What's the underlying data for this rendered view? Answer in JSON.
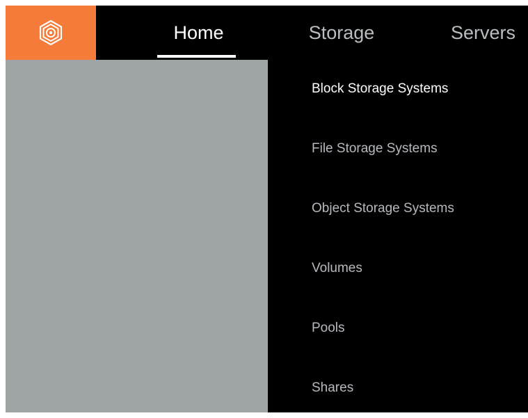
{
  "nav": {
    "logo_icon": "hexagon-logo-icon",
    "accent_color": "#f47b3a",
    "tabs": [
      {
        "label": "Home",
        "active": true
      },
      {
        "label": "Storage",
        "active": false
      },
      {
        "label": "Servers",
        "active": false
      }
    ]
  },
  "storage_menu": {
    "items": [
      {
        "label": "Block Storage Systems"
      },
      {
        "label": "File Storage Systems"
      },
      {
        "label": "Object Storage Systems"
      },
      {
        "label": "Volumes"
      },
      {
        "label": "Pools"
      },
      {
        "label": "Shares"
      }
    ]
  }
}
